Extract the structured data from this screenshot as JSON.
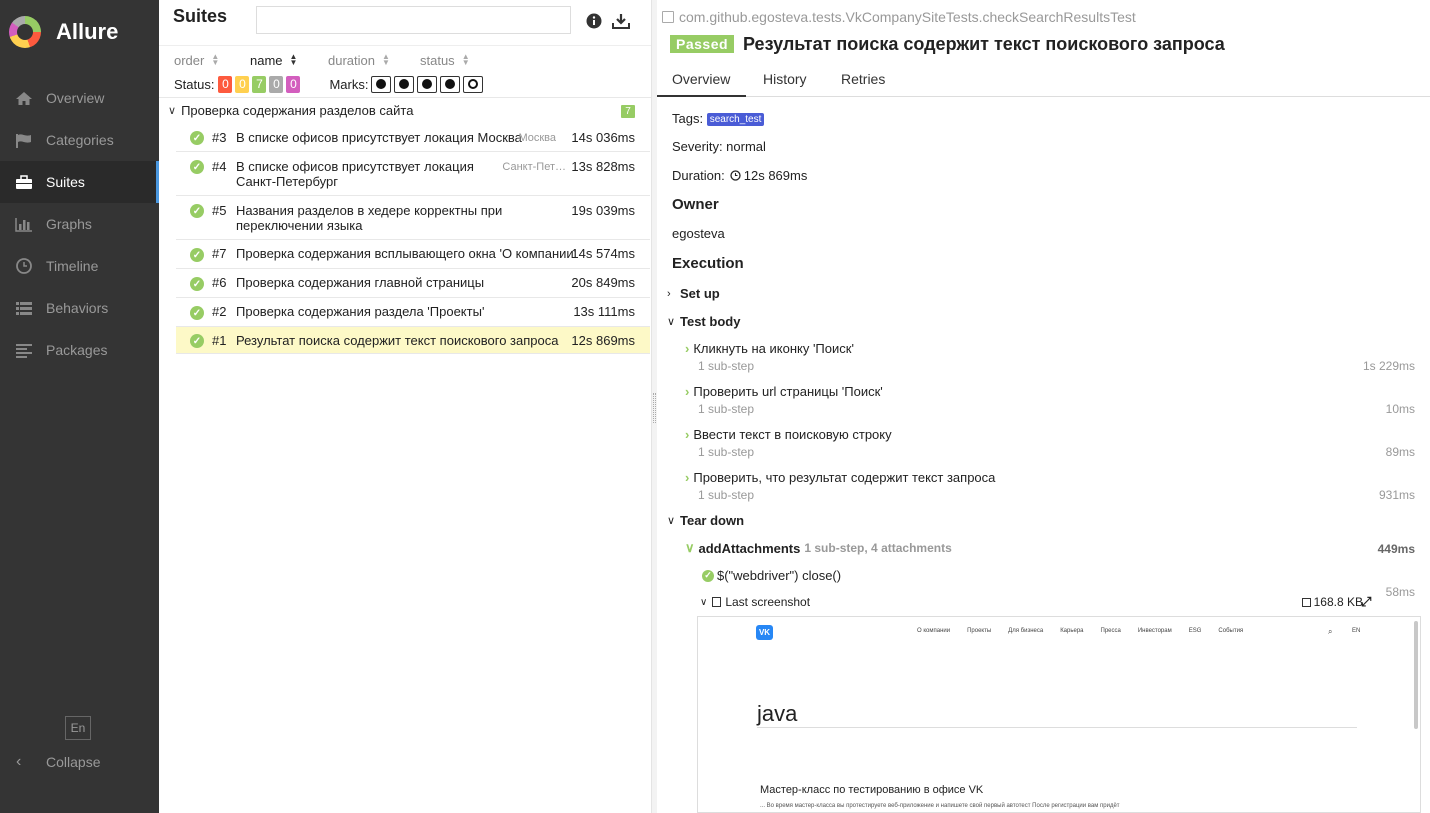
{
  "app": {
    "name": "Allure"
  },
  "sidebar": {
    "items": [
      {
        "label": "Overview",
        "icon": "home-icon"
      },
      {
        "label": "Categories",
        "icon": "flag-icon"
      },
      {
        "label": "Suites",
        "icon": "briefcase-icon"
      },
      {
        "label": "Graphs",
        "icon": "bar-chart-icon"
      },
      {
        "label": "Timeline",
        "icon": "clock-icon"
      },
      {
        "label": "Behaviors",
        "icon": "list-icon"
      },
      {
        "label": "Packages",
        "icon": "align-left-icon"
      }
    ],
    "active": "Suites",
    "lang": "En",
    "collapse": "Collapse"
  },
  "suites": {
    "title": "Suites",
    "search_placeholder": "",
    "sort": {
      "order": "order",
      "name": "name",
      "duration": "duration",
      "status": "status"
    },
    "status_label": "Status:",
    "marks_label": "Marks:",
    "status_counts": [
      {
        "value": "0",
        "color": "#fd5a3e"
      },
      {
        "value": "0",
        "color": "#ffd050"
      },
      {
        "value": "7",
        "color": "#97cc64"
      },
      {
        "value": "0",
        "color": "#aaaaaa"
      },
      {
        "value": "0",
        "color": "#d35ebe"
      }
    ],
    "group": {
      "name": "Проверка содержания разделов сайта",
      "count": "7"
    },
    "tests": [
      {
        "num": "#3",
        "name": "В списке офисов присутствует локация Москва",
        "param": "Москва",
        "duration": "14s 036ms"
      },
      {
        "num": "#4",
        "name": "В списке офисов присутствует локация Санкт-Петербург",
        "param": "Санкт-Пет…",
        "duration": "13s 828ms"
      },
      {
        "num": "#5",
        "name": "Названия разделов в хедере корректны при переключении языка",
        "param": "",
        "duration": "19s 039ms"
      },
      {
        "num": "#7",
        "name": "Проверка содержания всплывающего окна 'О компании'",
        "param": "",
        "duration": "14s 574ms"
      },
      {
        "num": "#6",
        "name": "Проверка содержания главной страницы",
        "param": "",
        "duration": "20s 849ms"
      },
      {
        "num": "#2",
        "name": "Проверка содержания раздела 'Проекты'",
        "param": "",
        "duration": "13s 111ms"
      },
      {
        "num": "#1",
        "name": "Результат поиска содержит текст поискового запроса",
        "param": "",
        "duration": "12s 869ms"
      }
    ]
  },
  "detail": {
    "full_name": "com.github.egosteva.tests.VkCompanySiteTests.checkSearchResultsTest",
    "status": "Passed",
    "title": "Результат поиска содержит текст поискового запроса",
    "tabs": [
      "Overview",
      "History",
      "Retries"
    ],
    "tags_label": "Tags:",
    "tag": "search_test",
    "severity": "Severity: normal",
    "duration_label": "Duration:",
    "duration": "12s 869ms",
    "owner_heading": "Owner",
    "owner": "egosteva",
    "execution_heading": "Execution",
    "setup": "Set up",
    "test_body": "Test body",
    "steps": [
      {
        "name": "Кликнуть на иконку 'Поиск'",
        "sub": "1 sub-step",
        "time": "1s 229ms"
      },
      {
        "name": "Проверить url страницы 'Поиск'",
        "sub": "1 sub-step",
        "time": "10ms"
      },
      {
        "name": "Ввести текст в поисковую строку",
        "sub": "1 sub-step",
        "time": "89ms"
      },
      {
        "name": "Проверить, что результат содержит текст запроса",
        "sub": "1 sub-step",
        "time": "931ms"
      }
    ],
    "teardown": "Tear down",
    "attach_step": {
      "name": "addAttachments",
      "meta": "1 sub-step, 4 attachments",
      "time": "449ms"
    },
    "close_step": {
      "name": "$(\"webdriver\") close()",
      "time": "58ms"
    },
    "attachment": {
      "name": "Last screenshot",
      "size": "168.8 KB"
    },
    "screenshot": {
      "nav": [
        "О компании",
        "Проекты",
        "Для бизнеса",
        "Карьера",
        "Пресса",
        "Инвесторам",
        "ESG",
        "События"
      ],
      "lang": "EN",
      "query": "java",
      "result_title": "Мастер-класс по тестированию в офисе VK",
      "result_text": "... Во время мастер-класса вы протестируете веб-приложение и напишете свой первый автотест После регистрации вам придёт"
    }
  }
}
